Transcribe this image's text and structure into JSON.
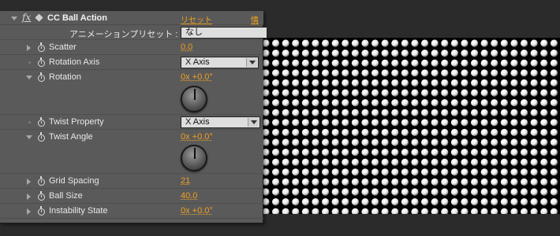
{
  "effect": {
    "name": "CC Ball Action",
    "fx_label": "fx",
    "reset_label": "リセット",
    "info_label": "情報",
    "preset_label": "アニメーションプリセット :",
    "preset_value": "なし"
  },
  "properties": [
    {
      "label": "Scatter",
      "value": "0.0"
    },
    {
      "label": "Rotation Axis",
      "value": "X Axis"
    },
    {
      "label": "Rotation",
      "value": "0x +0.0°"
    },
    {
      "label": "Twist Property",
      "value": "X Axis"
    },
    {
      "label": "Twist Angle",
      "value": "0x +0.0°"
    },
    {
      "label": "Grid Spacing",
      "value": "21"
    },
    {
      "label": "Ball Size",
      "value": "40.0"
    },
    {
      "label": "Instability State",
      "value": "0x +0.0°"
    }
  ],
  "colors": {
    "panel": "#5a5a5a",
    "value": "#f0a020",
    "preview_bg": "#000000",
    "ball": "#e6e6e6"
  }
}
